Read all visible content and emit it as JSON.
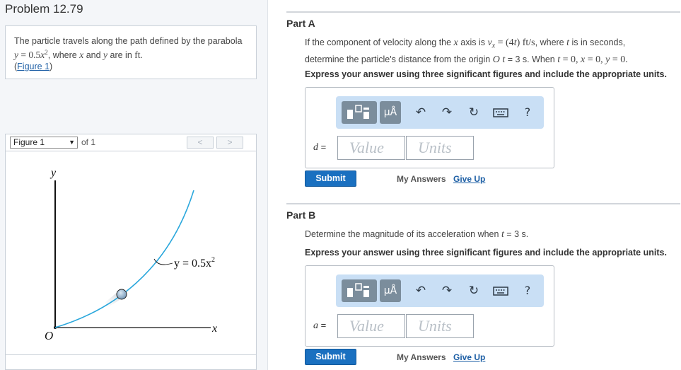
{
  "problem": {
    "title": "Problem 12.79",
    "text_before_eq": "The particle travels along the path defined by the parabola ",
    "eq_y": "y",
    "eq_mid": " = 0.5",
    "eq_x": "x",
    "eq_exp": "2",
    "text_where": ", where ",
    "var_x": "x",
    "text_and": " and ",
    "var_y": "y",
    "text_are_in": " are in ",
    "unit_ft": "ft",
    "text_period": ".",
    "figure_link_open": "(",
    "figure_link": "Figure 1",
    "figure_link_close": ")"
  },
  "figure_nav": {
    "selected": "Figure 1",
    "of_label": "of 1",
    "prev_label": "<",
    "next_label": ">"
  },
  "figure": {
    "axis_y_label": "y",
    "axis_x_label": "x",
    "origin_label": "O",
    "curve_label": "y = 0.5x",
    "curve_label_exp": "2",
    "colors": {
      "curve": "#2aa7dc",
      "particle": "#8fb2cf",
      "axis": "#111111"
    }
  },
  "part_a": {
    "title": "Part A",
    "q_1": "If the component of velocity along the ",
    "q_x": "x",
    "q_2": " axis is ",
    "q_vx": "v",
    "q_vx_sub": "x",
    "q_3": " = (4",
    "q_t": "t",
    "q_4": ") ft/s",
    "q_5": ", where ",
    "q_t2": "t",
    "q_6": " is in seconds,",
    "q_line2a": "determine the particle's distance from the origin ",
    "q_O": "O",
    "q_line2b": " ",
    "q_t3": "t",
    "q_line2c": " = 3 s. When ",
    "q_t4": "t",
    "q_eq0a": " = 0, ",
    "q_x0": "x",
    "q_eq0b": " = 0, ",
    "q_y0": "y",
    "q_eq0c": " = 0.",
    "instruction": "Express your answer using three significant figures and include the appropriate units.",
    "var_label": "d",
    "var_eq": " =",
    "value_placeholder": "Value",
    "units_placeholder": "Units",
    "submit": "Submit",
    "my_answers": "My Answers",
    "give_up": "Give Up"
  },
  "part_b": {
    "title": "Part B",
    "q_1": "Determine the magnitude of its acceleration when ",
    "q_t": "t",
    "q_2": " = 3 s.",
    "instruction": "Express your answer using three significant figures and include the appropriate units.",
    "var_label": "a",
    "var_eq": " =",
    "value_placeholder": "Value",
    "units_placeholder": "Units",
    "submit": "Submit",
    "my_answers": "My Answers",
    "give_up": "Give Up"
  },
  "toolbar": {
    "units_label": "μÅ",
    "undo_icon": "undo-icon",
    "redo_icon": "redo-icon",
    "reset_icon": "reset-icon",
    "keyboard_icon": "keyboard-icon",
    "help_label": "?"
  }
}
